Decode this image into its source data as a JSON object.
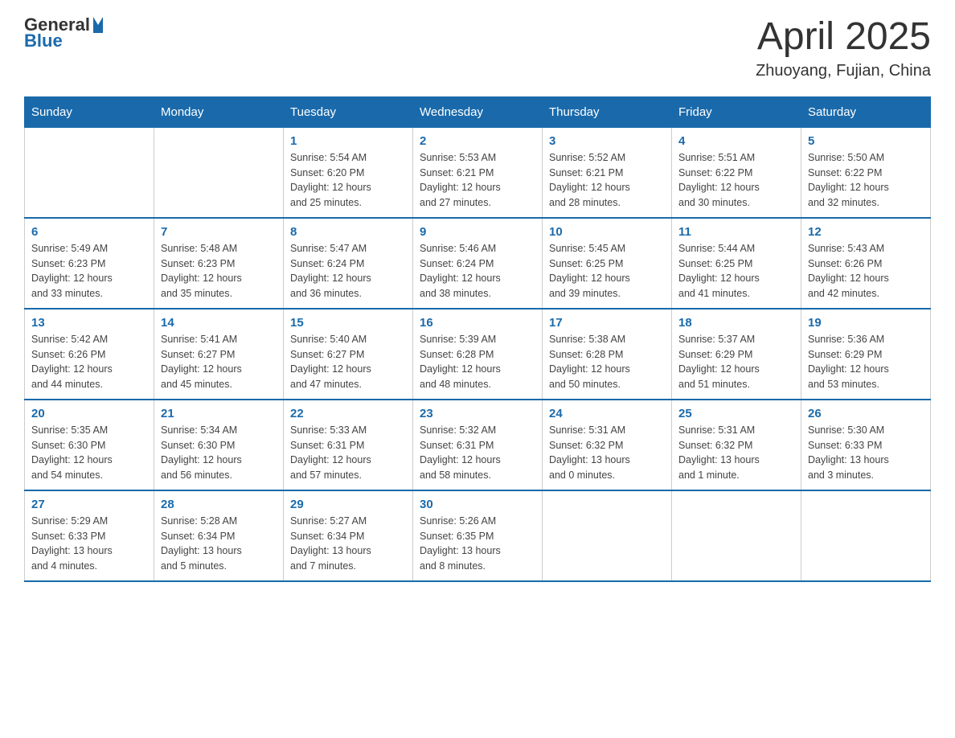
{
  "header": {
    "logo_general": "General",
    "logo_blue": "Blue",
    "month_year": "April 2025",
    "location": "Zhuoyang, Fujian, China"
  },
  "weekdays": [
    "Sunday",
    "Monday",
    "Tuesday",
    "Wednesday",
    "Thursday",
    "Friday",
    "Saturday"
  ],
  "weeks": [
    [
      {
        "day": "",
        "info": ""
      },
      {
        "day": "",
        "info": ""
      },
      {
        "day": "1",
        "info": "Sunrise: 5:54 AM\nSunset: 6:20 PM\nDaylight: 12 hours\nand 25 minutes."
      },
      {
        "day": "2",
        "info": "Sunrise: 5:53 AM\nSunset: 6:21 PM\nDaylight: 12 hours\nand 27 minutes."
      },
      {
        "day": "3",
        "info": "Sunrise: 5:52 AM\nSunset: 6:21 PM\nDaylight: 12 hours\nand 28 minutes."
      },
      {
        "day": "4",
        "info": "Sunrise: 5:51 AM\nSunset: 6:22 PM\nDaylight: 12 hours\nand 30 minutes."
      },
      {
        "day": "5",
        "info": "Sunrise: 5:50 AM\nSunset: 6:22 PM\nDaylight: 12 hours\nand 32 minutes."
      }
    ],
    [
      {
        "day": "6",
        "info": "Sunrise: 5:49 AM\nSunset: 6:23 PM\nDaylight: 12 hours\nand 33 minutes."
      },
      {
        "day": "7",
        "info": "Sunrise: 5:48 AM\nSunset: 6:23 PM\nDaylight: 12 hours\nand 35 minutes."
      },
      {
        "day": "8",
        "info": "Sunrise: 5:47 AM\nSunset: 6:24 PM\nDaylight: 12 hours\nand 36 minutes."
      },
      {
        "day": "9",
        "info": "Sunrise: 5:46 AM\nSunset: 6:24 PM\nDaylight: 12 hours\nand 38 minutes."
      },
      {
        "day": "10",
        "info": "Sunrise: 5:45 AM\nSunset: 6:25 PM\nDaylight: 12 hours\nand 39 minutes."
      },
      {
        "day": "11",
        "info": "Sunrise: 5:44 AM\nSunset: 6:25 PM\nDaylight: 12 hours\nand 41 minutes."
      },
      {
        "day": "12",
        "info": "Sunrise: 5:43 AM\nSunset: 6:26 PM\nDaylight: 12 hours\nand 42 minutes."
      }
    ],
    [
      {
        "day": "13",
        "info": "Sunrise: 5:42 AM\nSunset: 6:26 PM\nDaylight: 12 hours\nand 44 minutes."
      },
      {
        "day": "14",
        "info": "Sunrise: 5:41 AM\nSunset: 6:27 PM\nDaylight: 12 hours\nand 45 minutes."
      },
      {
        "day": "15",
        "info": "Sunrise: 5:40 AM\nSunset: 6:27 PM\nDaylight: 12 hours\nand 47 minutes."
      },
      {
        "day": "16",
        "info": "Sunrise: 5:39 AM\nSunset: 6:28 PM\nDaylight: 12 hours\nand 48 minutes."
      },
      {
        "day": "17",
        "info": "Sunrise: 5:38 AM\nSunset: 6:28 PM\nDaylight: 12 hours\nand 50 minutes."
      },
      {
        "day": "18",
        "info": "Sunrise: 5:37 AM\nSunset: 6:29 PM\nDaylight: 12 hours\nand 51 minutes."
      },
      {
        "day": "19",
        "info": "Sunrise: 5:36 AM\nSunset: 6:29 PM\nDaylight: 12 hours\nand 53 minutes."
      }
    ],
    [
      {
        "day": "20",
        "info": "Sunrise: 5:35 AM\nSunset: 6:30 PM\nDaylight: 12 hours\nand 54 minutes."
      },
      {
        "day": "21",
        "info": "Sunrise: 5:34 AM\nSunset: 6:30 PM\nDaylight: 12 hours\nand 56 minutes."
      },
      {
        "day": "22",
        "info": "Sunrise: 5:33 AM\nSunset: 6:31 PM\nDaylight: 12 hours\nand 57 minutes."
      },
      {
        "day": "23",
        "info": "Sunrise: 5:32 AM\nSunset: 6:31 PM\nDaylight: 12 hours\nand 58 minutes."
      },
      {
        "day": "24",
        "info": "Sunrise: 5:31 AM\nSunset: 6:32 PM\nDaylight: 13 hours\nand 0 minutes."
      },
      {
        "day": "25",
        "info": "Sunrise: 5:31 AM\nSunset: 6:32 PM\nDaylight: 13 hours\nand 1 minute."
      },
      {
        "day": "26",
        "info": "Sunrise: 5:30 AM\nSunset: 6:33 PM\nDaylight: 13 hours\nand 3 minutes."
      }
    ],
    [
      {
        "day": "27",
        "info": "Sunrise: 5:29 AM\nSunset: 6:33 PM\nDaylight: 13 hours\nand 4 minutes."
      },
      {
        "day": "28",
        "info": "Sunrise: 5:28 AM\nSunset: 6:34 PM\nDaylight: 13 hours\nand 5 minutes."
      },
      {
        "day": "29",
        "info": "Sunrise: 5:27 AM\nSunset: 6:34 PM\nDaylight: 13 hours\nand 7 minutes."
      },
      {
        "day": "30",
        "info": "Sunrise: 5:26 AM\nSunset: 6:35 PM\nDaylight: 13 hours\nand 8 minutes."
      },
      {
        "day": "",
        "info": ""
      },
      {
        "day": "",
        "info": ""
      },
      {
        "day": "",
        "info": ""
      }
    ]
  ]
}
